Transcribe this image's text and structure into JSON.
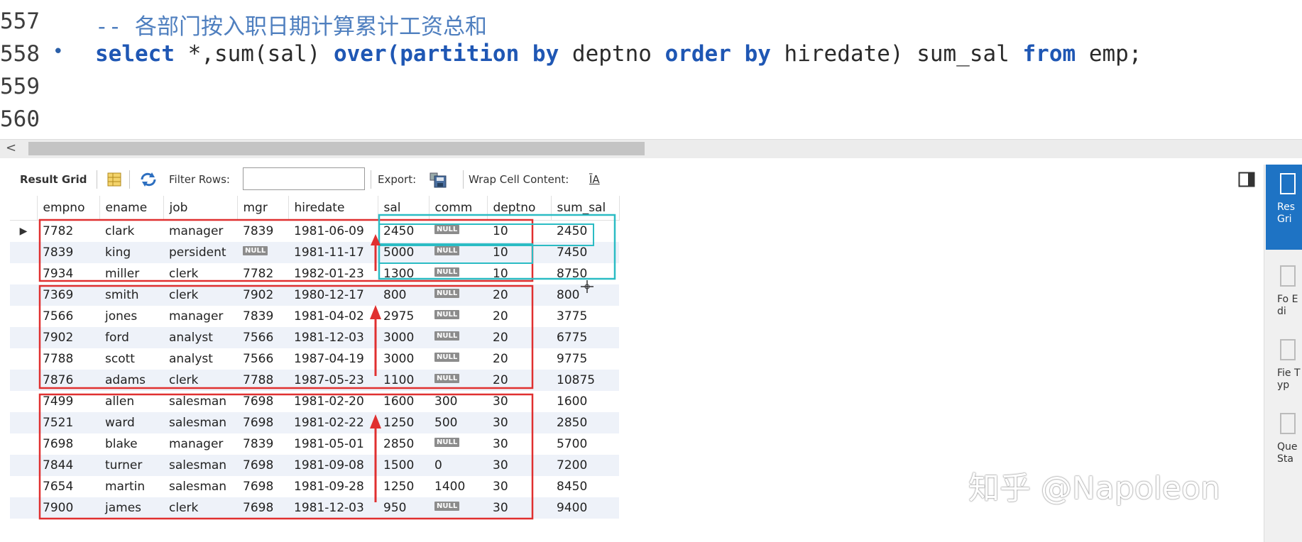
{
  "editor": {
    "lines": [
      {
        "num": "557",
        "code_comment": "-- 各部门按入职日期计算累计工资总和"
      },
      {
        "num": "558",
        "marker": "•",
        "tokens": [
          {
            "t": "select",
            "c": "kw"
          },
          {
            "t": " *,sum(sal) ",
            "c": "plain"
          },
          {
            "t": "over(partition",
            "c": "kw"
          },
          {
            "t": " ",
            "c": "plain"
          },
          {
            "t": "by",
            "c": "kw"
          },
          {
            "t": " deptno ",
            "c": "plain"
          },
          {
            "t": "order",
            "c": "kw"
          },
          {
            "t": " ",
            "c": "plain"
          },
          {
            "t": "by",
            "c": "kw"
          },
          {
            "t": " hiredate) sum_sal ",
            "c": "plain"
          },
          {
            "t": "from",
            "c": "kw"
          },
          {
            "t": " emp;",
            "c": "plain"
          }
        ]
      },
      {
        "num": "559"
      },
      {
        "num": "560"
      }
    ]
  },
  "hscroll": {
    "arrow": "<"
  },
  "toolbar": {
    "result_grid_label": "Result Grid",
    "filter_rows_label": "Filter Rows:",
    "filter_value": "",
    "export_label": "Export:",
    "wrap_label": "Wrap Cell Content:",
    "wrap_icon": "ĪA"
  },
  "grid": {
    "columns": [
      "empno",
      "ename",
      "job",
      "mgr",
      "hiredate",
      "sal",
      "comm",
      "deptno",
      "sum_sal"
    ],
    "null_label": "NULL",
    "rows": [
      [
        "7782",
        "clark",
        "manager",
        "7839",
        "1981-06-09",
        "2450",
        null,
        "10",
        "2450"
      ],
      [
        "7839",
        "king",
        "persident",
        null,
        "1981-11-17",
        "5000",
        null,
        "10",
        "7450"
      ],
      [
        "7934",
        "miller",
        "clerk",
        "7782",
        "1982-01-23",
        "1300",
        null,
        "10",
        "8750"
      ],
      [
        "7369",
        "smith",
        "clerk",
        "7902",
        "1980-12-17",
        "800",
        null,
        "20",
        "800"
      ],
      [
        "7566",
        "jones",
        "manager",
        "7839",
        "1981-04-02",
        "2975",
        null,
        "20",
        "3775"
      ],
      [
        "7902",
        "ford",
        "analyst",
        "7566",
        "1981-12-03",
        "3000",
        null,
        "20",
        "6775"
      ],
      [
        "7788",
        "scott",
        "analyst",
        "7566",
        "1987-04-19",
        "3000",
        null,
        "20",
        "9775"
      ],
      [
        "7876",
        "adams",
        "clerk",
        "7788",
        "1987-05-23",
        "1100",
        null,
        "20",
        "10875"
      ],
      [
        "7499",
        "allen",
        "salesman",
        "7698",
        "1981-02-20",
        "1600",
        "300",
        "30",
        "1600"
      ],
      [
        "7521",
        "ward",
        "salesman",
        "7698",
        "1981-02-22",
        "1250",
        "500",
        "30",
        "2850"
      ],
      [
        "7698",
        "blake",
        "manager",
        "7839",
        "1981-05-01",
        "2850",
        null,
        "30",
        "5700"
      ],
      [
        "7844",
        "turner",
        "salesman",
        "7698",
        "1981-09-08",
        "1500",
        "0",
        "30",
        "7200"
      ],
      [
        "7654",
        "martin",
        "salesman",
        "7698",
        "1981-09-28",
        "1250",
        "1400",
        "30",
        "8450"
      ],
      [
        "7900",
        "james",
        "clerk",
        "7698",
        "1981-12-03",
        "950",
        null,
        "30",
        "9400"
      ]
    ],
    "current_row_marker": "▶"
  },
  "right_panel": {
    "items": [
      {
        "label": "Res Gri",
        "active": true
      },
      {
        "label": "Fo Edi",
        "active": false
      },
      {
        "label": "Fie Typ",
        "active": false
      },
      {
        "label": "Que Sta",
        "active": false
      }
    ]
  },
  "watermark": "知乎 @Napoleon",
  "colors": {
    "annotation_red": "#e03030",
    "annotation_cyan": "#2bbcc4",
    "keyword_blue": "#1f57b4",
    "active_tab": "#1e73c4"
  }
}
